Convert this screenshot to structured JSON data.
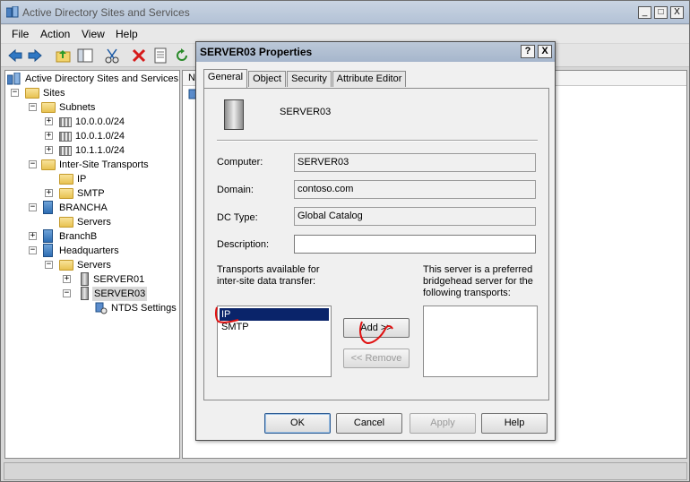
{
  "main": {
    "title": "Active Directory Sites and Services",
    "window_buttons": [
      "_",
      "□",
      "X"
    ],
    "menu": [
      "File",
      "Action",
      "View",
      "Help"
    ],
    "toolbar_icons": [
      "back-arrow-icon",
      "forward-arrow-icon",
      "up-folder-icon",
      "show-hide-tree-icon",
      "cut-icon",
      "delete-icon",
      "properties-icon",
      "refresh-icon"
    ],
    "right_pane_header": "N"
  },
  "tree": {
    "root": "Active Directory Sites and Services",
    "sites": "Sites",
    "subnets": "Subnets",
    "subnet_items": [
      "10.0.0.0/24",
      "10.0.1.0/24",
      "10.1.1.0/24"
    ],
    "inter_site": "Inter-Site Transports",
    "ip": "IP",
    "smtp": "SMTP",
    "brancha": "BRANCHA",
    "brancha_servers": "Servers",
    "branchb": "BranchB",
    "hq": "Headquarters",
    "hq_servers": "Servers",
    "server01": "SERVER01",
    "server03": "SERVER03",
    "ntds": "NTDS Settings"
  },
  "dialog": {
    "title": "SERVER03 Properties",
    "help_btn": "?",
    "close_btn": "X",
    "tabs": [
      "General",
      "Object",
      "Security",
      "Attribute Editor"
    ],
    "active_tab": "General",
    "server_name": "SERVER03",
    "computer_label": "Computer:",
    "computer_value": "SERVER03",
    "domain_label": "Domain:",
    "domain_value": "contoso.com",
    "dctype_label": "DC Type:",
    "dctype_value": "Global Catalog",
    "description_label": "Description:",
    "description_value": "",
    "transports_label_1": "Transports available for",
    "transports_label_2": "inter-site data transfer:",
    "transports": [
      "IP",
      "SMTP"
    ],
    "selected_transport": "IP",
    "preferred_label_1": "This server is a preferred",
    "preferred_label_2": "bridgehead server for the",
    "preferred_label_3": "following transports:",
    "add_btn": "Add >>",
    "remove_btn": "<< Remove",
    "ok_btn": "OK",
    "cancel_btn": "Cancel",
    "apply_btn": "Apply",
    "help_text_btn": "Help"
  },
  "colors": {
    "selection": "#0a246a",
    "annotation": "#e01010"
  }
}
